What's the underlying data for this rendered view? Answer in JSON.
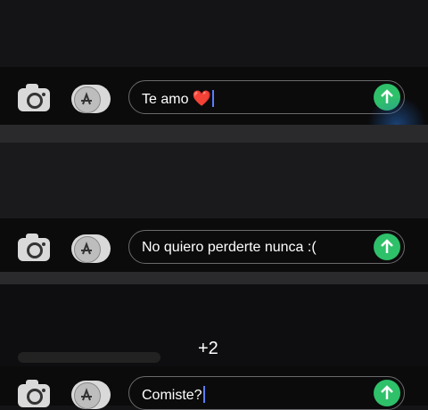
{
  "rows": [
    {
      "text": "Te amo",
      "extra": "❤️",
      "caret": true
    },
    {
      "text": "No quiero perderte nunca :(",
      "extra": "",
      "caret": false
    },
    {
      "text": "Comiste?",
      "extra": "",
      "caret": true
    }
  ],
  "overlay": {
    "plus_text": "+2"
  },
  "colors": {
    "send": "#2fc06a",
    "caret": "#5b7cff",
    "heart": "#e0405a"
  }
}
